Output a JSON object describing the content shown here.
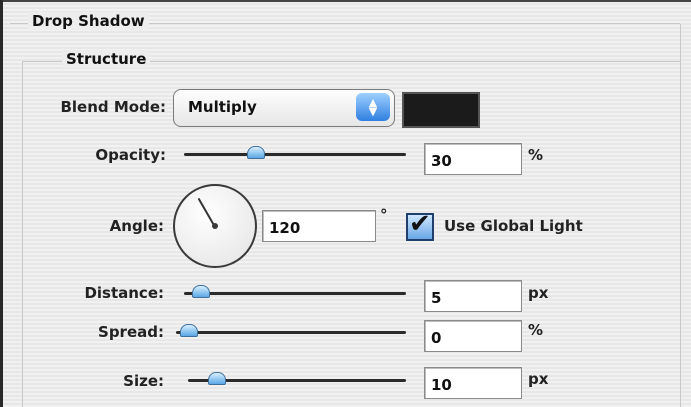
{
  "dialog": {
    "section_title": "Drop Shadow",
    "group_title": "Structure"
  },
  "blend_mode": {
    "label": "Blend Mode:",
    "value": "Multiply",
    "shadow_color": "#1b1b1b"
  },
  "opacity": {
    "label": "Opacity:",
    "value": "30",
    "unit": "%",
    "slider_fraction": 0.3
  },
  "angle": {
    "label": "Angle:",
    "value": "120",
    "unit": "°",
    "degrees": 120
  },
  "use_global_light": {
    "label": "Use Global Light",
    "checked": true
  },
  "distance": {
    "label": "Distance:",
    "value": "5",
    "unit": "px",
    "slider_fraction": 0.02
  },
  "spread": {
    "label": "Spread:",
    "value": "0",
    "unit": "%",
    "slider_fraction": 0.0
  },
  "size": {
    "label": "Size:",
    "value": "10",
    "unit": "px",
    "slider_fraction": 0.08
  }
}
